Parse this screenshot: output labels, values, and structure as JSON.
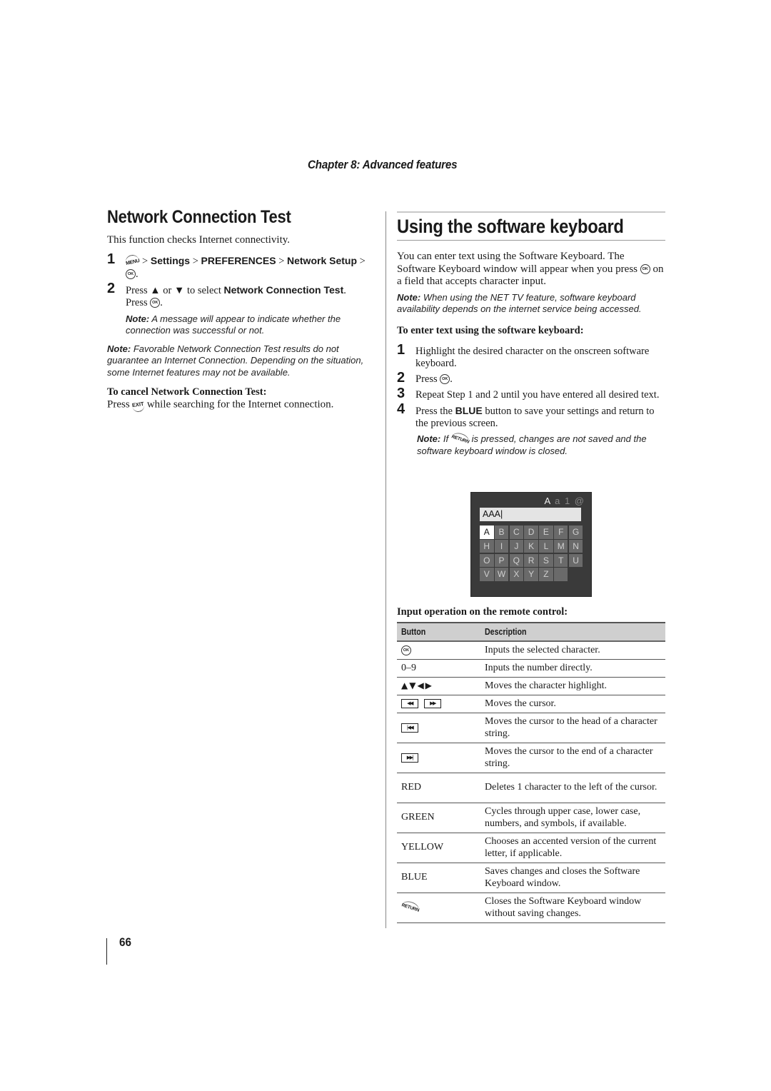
{
  "header": {
    "chapter": "Chapter 8: Advanced features"
  },
  "left": {
    "title": "Network Connection Test",
    "intro": "This function checks Internet connectivity.",
    "steps": [
      {
        "num": "1",
        "icon": "MENU",
        "sep1": " > ",
        "p1": "Settings",
        "sep2": " > ",
        "p2": "PREFERENCES",
        "sep3": " > ",
        "p3": "Network Setup",
        "sep4": " > ",
        "end": "."
      },
      {
        "num": "2",
        "pre": "Press ",
        "up": "▲",
        "or": " or ",
        "down": "▼",
        "mid": " to select ",
        "target": "Network Connection Test",
        "dot": ".",
        "press": "Press ",
        "end": "."
      }
    ],
    "step_note": {
      "label": "Note:",
      "text": " A message will appear to indicate whether the connection was successful or not."
    },
    "note": {
      "label": "Note:",
      "text": " Favorable Network Connection Test results do not guarantee an Internet Connection. Depending on the situation, some Internet features may not be available."
    },
    "cancel": {
      "heading": "To cancel Network Connection Test:",
      "pre": "Press ",
      "icon": "EXIT",
      "post": " while searching for the Internet connection."
    }
  },
  "right": {
    "title": "Using the software keyboard",
    "intro_a": "You can enter text using the Software Keyboard. The Software Keyboard window will appear when you press ",
    "intro_b": " on a field that accepts character input.",
    "note": {
      "label": "Note:",
      "text": " When using the NET TV feature, software keyboard availability depends on the internet service being accessed."
    },
    "subhead": "To enter text using the software keyboard:",
    "steps": [
      {
        "num": "1",
        "text": "Highlight the desired character on the onscreen software keyboard."
      },
      {
        "num": "2",
        "pre": "Press ",
        "post": "."
      },
      {
        "num": "3",
        "text": "Repeat Step 1 and 2 until you have entered all desired text."
      },
      {
        "num": "4",
        "pre": "Press the ",
        "bold": "BLUE",
        "post": " button to save your settings and return to the previous screen."
      }
    ],
    "step_note": {
      "label": "Note:",
      "pre": " If ",
      "icon": "RETURN",
      "post": " is pressed, changes are not saved and the software keyboard window is closed."
    },
    "keyboard": {
      "modes": [
        "A",
        "a",
        "1",
        "@"
      ],
      "active_mode": "A",
      "field_value": "AAA|",
      "keys": [
        "A",
        "B",
        "C",
        "D",
        "E",
        "F",
        "G",
        "H",
        "I",
        "J",
        "K",
        "L",
        "M",
        "N",
        "O",
        "P",
        "Q",
        "R",
        "S",
        "T",
        "U",
        "V",
        "W",
        "X",
        "Y",
        "Z",
        ""
      ],
      "selected_key": "A"
    },
    "table_caption": "Input operation on the remote control:",
    "table": {
      "headers": [
        "Button",
        "Description"
      ],
      "rows": [
        {
          "button": "OK",
          "button_type": "ok-icon",
          "desc": "Inputs the selected character."
        },
        {
          "button": "0–9",
          "button_type": "text",
          "desc": "Inputs the number directly."
        },
        {
          "button": "▲▼◀▶",
          "button_type": "arrows",
          "desc": "Moves the character highlight."
        },
        {
          "button": "◀◀ ▶▶",
          "button_type": "rewind-forward-icons",
          "desc": "Moves the cursor."
        },
        {
          "button": "|◀◀",
          "button_type": "skip-back-icon",
          "desc": "Moves the cursor to the head of a character string."
        },
        {
          "button": "▶▶|",
          "button_type": "skip-forward-icon",
          "desc": "Moves the cursor to the end of a character string."
        },
        {
          "button": "RED",
          "button_type": "text",
          "desc": "Deletes 1 character to the left of the cursor."
        },
        {
          "button": "GREEN",
          "button_type": "text",
          "desc": "Cycles through upper case, lower case, numbers, and symbols, if available."
        },
        {
          "button": "YELLOW",
          "button_type": "text",
          "desc": "Chooses an accented version of the current letter, if applicable."
        },
        {
          "button": "BLUE",
          "button_type": "text",
          "desc": "Saves changes and closes the Software Keyboard window."
        },
        {
          "button": "RETURN",
          "button_type": "return-icon",
          "desc": "Closes the Software Keyboard window without saving changes."
        }
      ]
    }
  },
  "footer": {
    "page_number": "66"
  },
  "icons": {
    "ok": "OK",
    "rewind": "◀◀",
    "forward": "▶▶",
    "skip_back": "|◀◀",
    "skip_forward": "▶▶|"
  }
}
